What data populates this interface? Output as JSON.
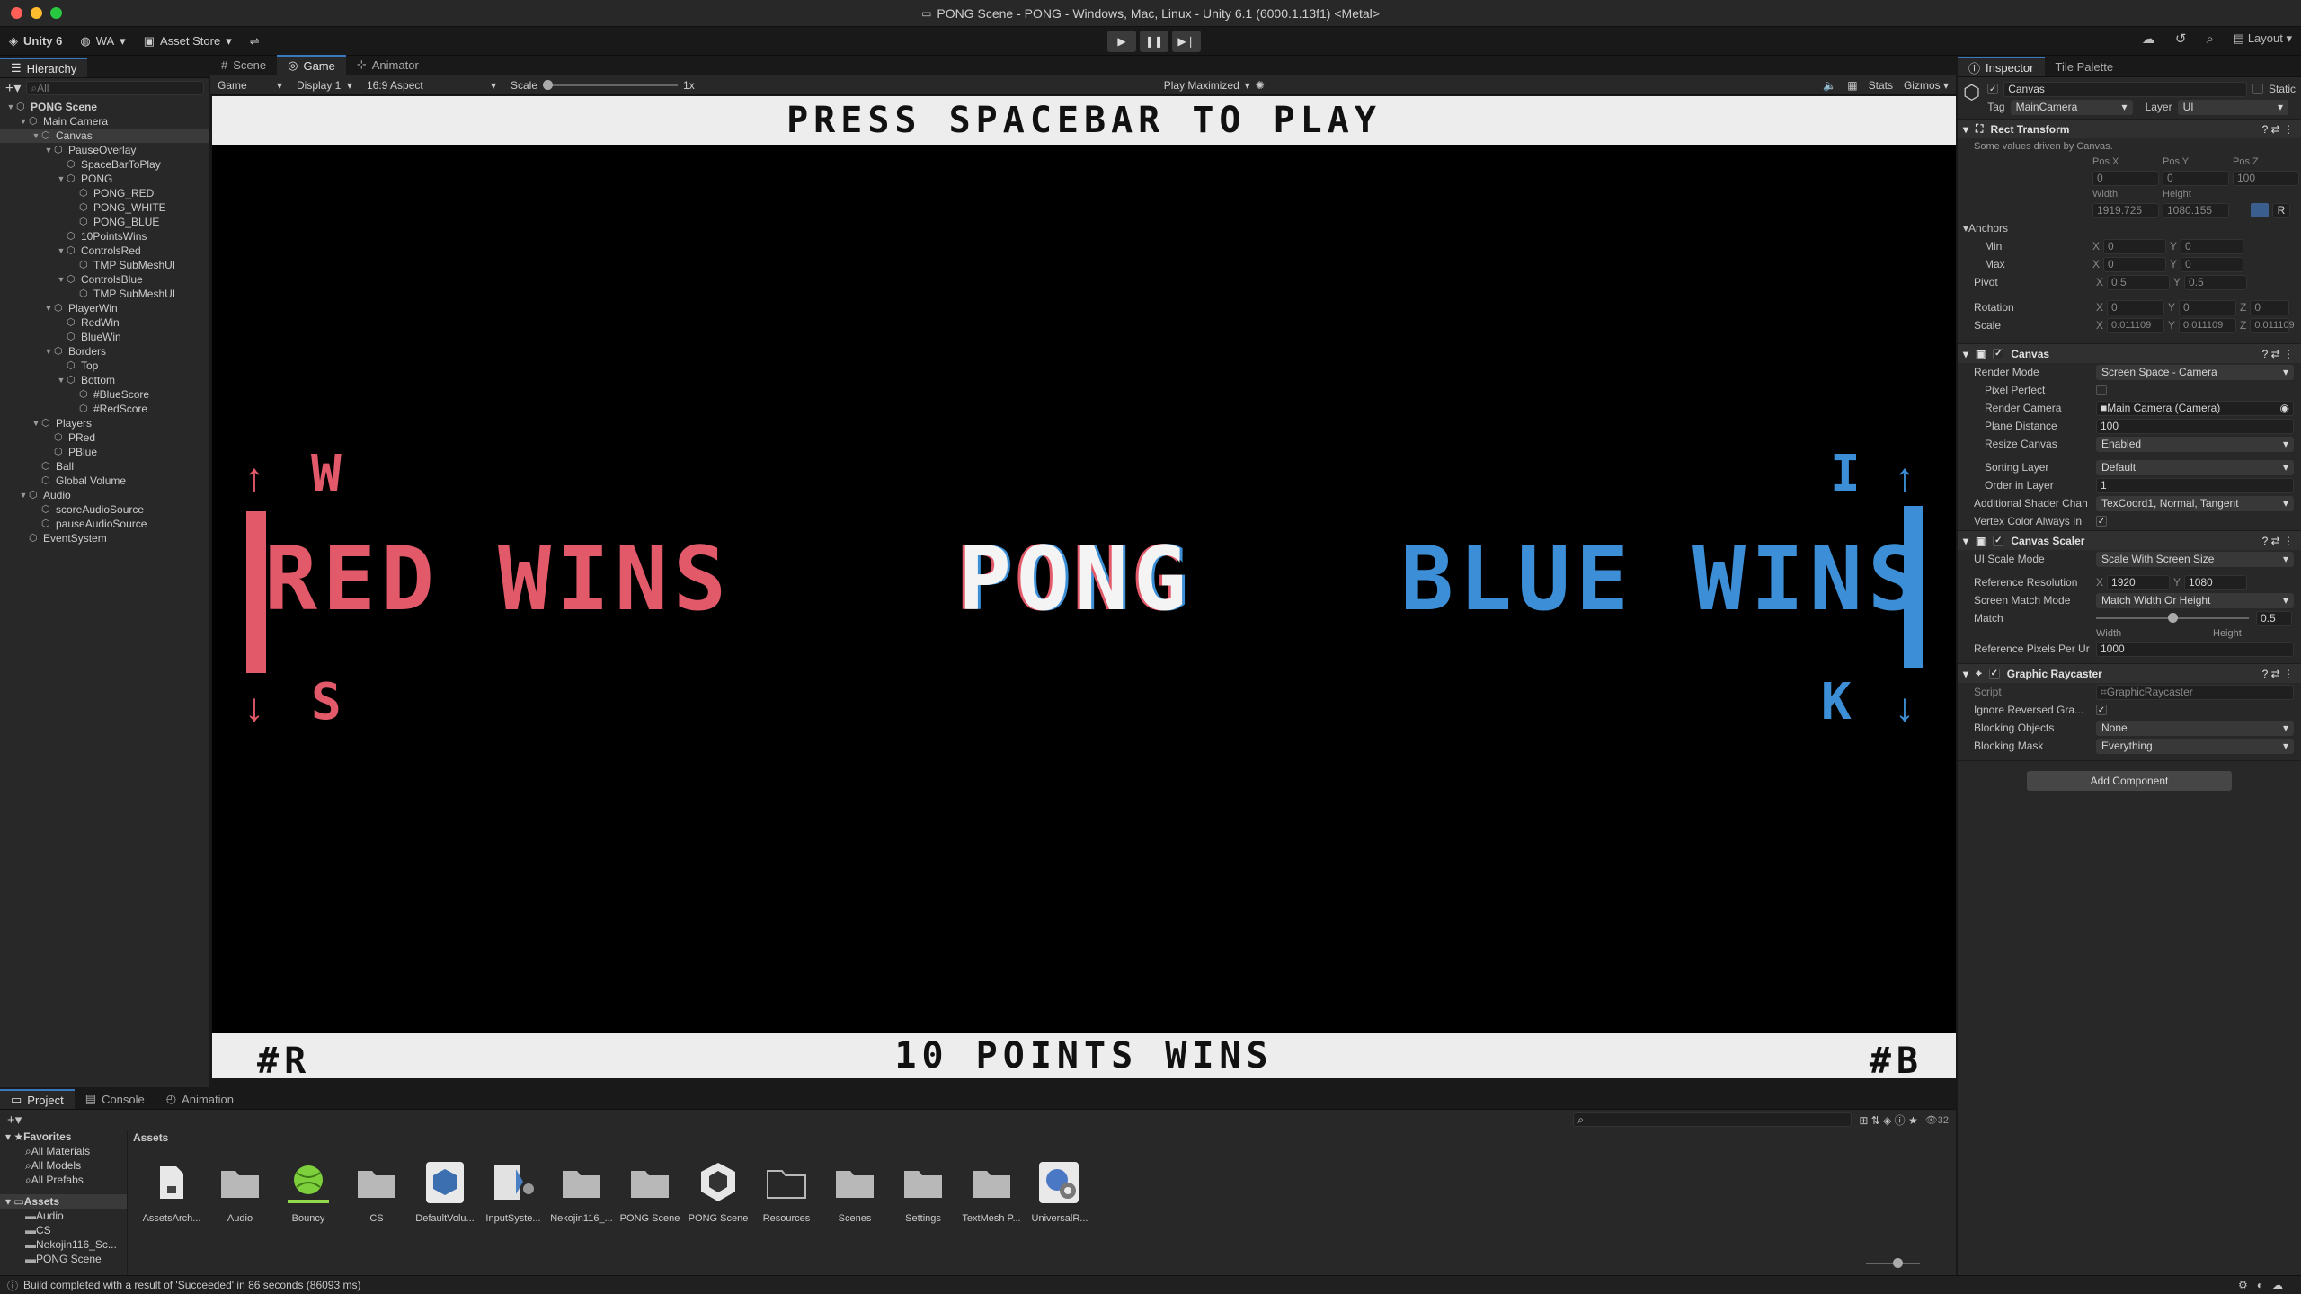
{
  "window": {
    "title": "PONG Scene - PONG - Windows, Mac, Linux - Unity 6.1 (6000.1.13f1) <Metal>"
  },
  "toolbar": {
    "account": "Unity 6",
    "workspace": "WA",
    "asset_store": "Asset Store",
    "layout": "Layout"
  },
  "hierarchy": {
    "tab": "Hierarchy",
    "search_placeholder": "All",
    "rows": [
      {
        "label": "PONG Scene",
        "depth": 0,
        "bold": true,
        "arrow": "▼"
      },
      {
        "label": "Main Camera",
        "depth": 1,
        "arrow": "▼"
      },
      {
        "label": "Canvas",
        "depth": 2,
        "arrow": "▼",
        "selected": true
      },
      {
        "label": "PauseOverlay",
        "depth": 3,
        "arrow": "▼"
      },
      {
        "label": "SpaceBarToPlay",
        "depth": 4,
        "arrow": ""
      },
      {
        "label": "PONG",
        "depth": 4,
        "arrow": "▼"
      },
      {
        "label": "PONG_RED",
        "depth": 5,
        "arrow": ""
      },
      {
        "label": "PONG_WHITE",
        "depth": 5,
        "arrow": ""
      },
      {
        "label": "PONG_BLUE",
        "depth": 5,
        "arrow": ""
      },
      {
        "label": "10PointsWins",
        "depth": 4,
        "arrow": ""
      },
      {
        "label": "ControlsRed",
        "depth": 4,
        "arrow": "▼"
      },
      {
        "label": "TMP SubMeshUI",
        "depth": 5,
        "arrow": ""
      },
      {
        "label": "ControlsBlue",
        "depth": 4,
        "arrow": "▼"
      },
      {
        "label": "TMP SubMeshUI",
        "depth": 5,
        "arrow": ""
      },
      {
        "label": "PlayerWin",
        "depth": 3,
        "arrow": "▼"
      },
      {
        "label": "RedWin",
        "depth": 4,
        "arrow": ""
      },
      {
        "label": "BlueWin",
        "depth": 4,
        "arrow": ""
      },
      {
        "label": "Borders",
        "depth": 3,
        "arrow": "▼"
      },
      {
        "label": "Top",
        "depth": 4,
        "arrow": ""
      },
      {
        "label": "Bottom",
        "depth": 4,
        "arrow": "▼"
      },
      {
        "label": "#BlueScore",
        "depth": 5,
        "arrow": ""
      },
      {
        "label": "#RedScore",
        "depth": 5,
        "arrow": ""
      },
      {
        "label": "Players",
        "depth": 2,
        "arrow": "▼"
      },
      {
        "label": "PRed",
        "depth": 3,
        "arrow": ""
      },
      {
        "label": "PBlue",
        "depth": 3,
        "arrow": ""
      },
      {
        "label": "Ball",
        "depth": 2,
        "arrow": ""
      },
      {
        "label": "Global Volume",
        "depth": 2,
        "arrow": ""
      },
      {
        "label": "Audio",
        "depth": 1,
        "arrow": "▼"
      },
      {
        "label": "scoreAudioSource",
        "depth": 2,
        "arrow": ""
      },
      {
        "label": "pauseAudioSource",
        "depth": 2,
        "arrow": ""
      },
      {
        "label": "EventSystem",
        "depth": 1,
        "arrow": ""
      }
    ]
  },
  "center_tabs": {
    "scene": "Scene",
    "game": "Game",
    "animator": "Animator"
  },
  "game_bar": {
    "mode": "Game",
    "display": "Display 1",
    "aspect": "16:9 Aspect",
    "scale_label": "Scale",
    "scale_value": "1x",
    "play_mode": "Play Maximized",
    "stats": "Stats",
    "gizmos": "Gizmos"
  },
  "game": {
    "top_text": "PRESS SPACEBAR TO PLAY",
    "bottom_text": "10 POINTS WINS",
    "red_score": "#R",
    "blue_score": "#B",
    "red_wins": "RED WINS",
    "pong": "PONG",
    "blue_wins": "BLUE WINS",
    "key_w": "W",
    "key_s": "S",
    "key_i": "I",
    "key_k": "K",
    "up_arrow": "↑",
    "down_arrow": "↓",
    "red_color": "#e25a6a",
    "blue_color": "#3c8fd6"
  },
  "inspector": {
    "tab": "Inspector",
    "tab2": "Tile Palette",
    "object_name": "Canvas",
    "static": "Static",
    "tag_label": "Tag",
    "tag_value": "MainCamera",
    "layer_label": "Layer",
    "layer_value": "UI",
    "rect": {
      "title": "Rect Transform",
      "note": "Some values driven by Canvas.",
      "posx_l": "Pos X",
      "posy_l": "Pos Y",
      "posz_l": "Pos Z",
      "posx": "0",
      "posy": "0",
      "posz": "100",
      "width_l": "Width",
      "height_l": "Height",
      "width": "1919.725",
      "height": "1080.155",
      "anchors": "Anchors",
      "min": "Min",
      "max": "Max",
      "min_x": "0",
      "min_y": "0",
      "max_x": "0",
      "max_y": "0",
      "pivot": "Pivot",
      "pivot_x": "0.5",
      "pivot_y": "0.5",
      "rotation": "Rotation",
      "rot_x": "0",
      "rot_y": "0",
      "rot_z": "0",
      "scale": "Scale",
      "scale_x": "0.011109",
      "scale_y": "0.011109",
      "scale_z": "0.011109",
      "r_btn": "R"
    },
    "canvas": {
      "title": "Canvas",
      "render_mode_l": "Render Mode",
      "render_mode": "Screen Space - Camera",
      "pixel_perfect_l": "Pixel Perfect",
      "render_camera_l": "Render Camera",
      "render_camera": "Main Camera (Camera)",
      "plane_distance_l": "Plane Distance",
      "plane_distance": "100",
      "resize_canvas_l": "Resize Canvas",
      "resize_canvas": "Enabled",
      "sorting_layer_l": "Sorting Layer",
      "sorting_layer": "Default",
      "order_l": "Order in Layer",
      "order": "1",
      "shader_l": "Additional Shader Chan",
      "shader": "TexCoord1, Normal, Tangent",
      "vertex_l": "Vertex Color Always In"
    },
    "scaler": {
      "title": "Canvas Scaler",
      "ui_scale_l": "UI Scale Mode",
      "ui_scale": "Scale With Screen Size",
      "ref_res_l": "Reference Resolution",
      "ref_x": "1920",
      "ref_y": "1080",
      "match_mode_l": "Screen Match Mode",
      "match_mode": "Match Width Or Height",
      "match_l": "Match",
      "match": "0.5",
      "width_l": "Width",
      "height_l": "Height",
      "ppu_l": "Reference Pixels Per Ur",
      "ppu": "1000"
    },
    "raycaster": {
      "title": "Graphic Raycaster",
      "script_l": "Script",
      "script": "GraphicRaycaster",
      "ignore_l": "Ignore Reversed Gra...",
      "blocking_l": "Blocking Objects",
      "blocking": "None",
      "mask_l": "Blocking Mask",
      "mask": "Everything"
    },
    "add_component": "Add Component"
  },
  "project": {
    "tab": "Project",
    "console": "Console",
    "animation": "Animation",
    "breadcrumb": "Assets",
    "count": "32",
    "favorites": {
      "title": "Favorites",
      "items": [
        "All Materials",
        "All Models",
        "All Prefabs"
      ]
    },
    "tree": {
      "title": "Assets",
      "items": [
        "Audio",
        "CS",
        "Nekojin116_Sc...",
        "PONG Scene"
      ]
    },
    "assets": [
      {
        "name": "AssetsArch...",
        "icon": "file"
      },
      {
        "name": "Audio",
        "icon": "folder"
      },
      {
        "name": "Bouncy",
        "icon": "ball"
      },
      {
        "name": "CS",
        "icon": "folder"
      },
      {
        "name": "DefaultVolu...",
        "icon": "volume"
      },
      {
        "name": "InputSyste...",
        "icon": "input"
      },
      {
        "name": "Nekojin116_...",
        "icon": "folder"
      },
      {
        "name": "PONG Scene",
        "icon": "folder"
      },
      {
        "name": "PONG Scene",
        "icon": "unity"
      },
      {
        "name": "Resources",
        "icon": "folder-open"
      },
      {
        "name": "Scenes",
        "icon": "folder"
      },
      {
        "name": "Settings",
        "icon": "folder"
      },
      {
        "name": "TextMesh P...",
        "icon": "folder"
      },
      {
        "name": "UniversalR...",
        "icon": "gear"
      }
    ]
  },
  "status": "Build completed with a result of 'Succeeded' in 86 seconds (86093 ms)"
}
